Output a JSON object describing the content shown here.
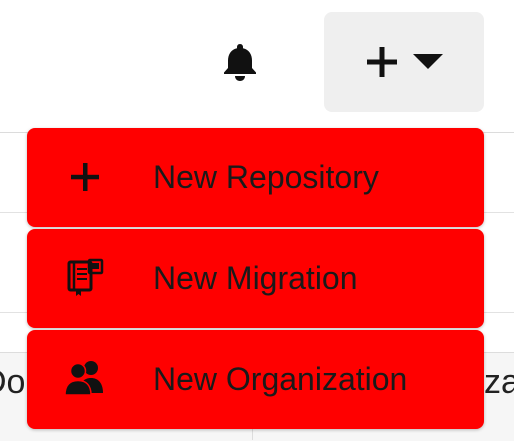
{
  "header": {
    "notifications_icon": "bell-icon",
    "create_button": {
      "icon": "plus-icon",
      "caret_icon": "caret-down-icon"
    }
  },
  "menu": {
    "items": [
      {
        "label": "New Repository",
        "icon": "plus-icon"
      },
      {
        "label": "New Migration",
        "icon": "migration-book-icon"
      },
      {
        "label": "New Organization",
        "icon": "organization-people-icon"
      }
    ]
  },
  "background": {
    "left_text_fragment": "Do",
    "right_text_fragment": "zat"
  },
  "colors": {
    "menu_item_bg": "#ff0000",
    "button_bg": "#efefef",
    "text": "#1a1a1a"
  }
}
